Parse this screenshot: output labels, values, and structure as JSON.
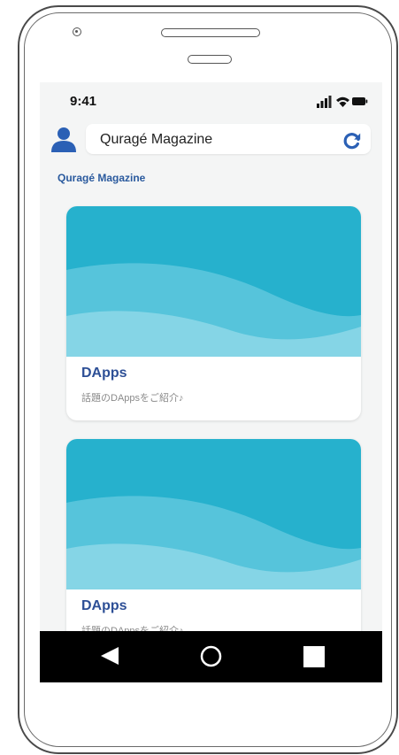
{
  "status_bar": {
    "time": "9:41",
    "icons": [
      "signal-icon",
      "wifi-icon",
      "battery-icon"
    ]
  },
  "header": {
    "search_text": "Quragé Magazine",
    "avatar_icon": "user-icon",
    "refresh_icon": "refresh-icon"
  },
  "section": {
    "title": "Quragé Magazine"
  },
  "cards": [
    {
      "title": "DApps",
      "subtitle": "話題のDAppsをご紹介♪"
    },
    {
      "title": "DApps",
      "subtitle": "話題のDAppsをご紹介♪"
    }
  ],
  "nav_bar": {
    "icons": [
      "back-icon",
      "home-icon",
      "recent-apps-icon"
    ]
  },
  "colors": {
    "accent": "#2b60b5",
    "banner": "#26b1cd",
    "title": "#2d4f96"
  }
}
